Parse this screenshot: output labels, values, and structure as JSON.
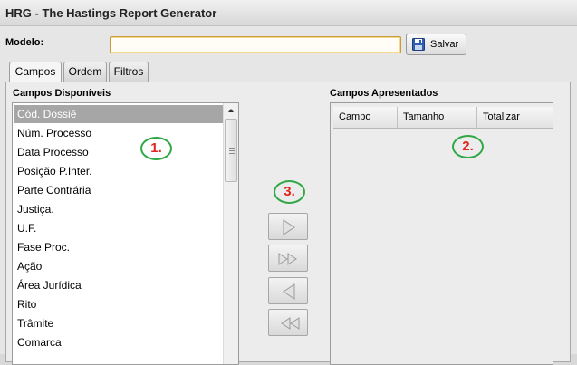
{
  "window": {
    "title": "HRG - The Hastings Report Generator"
  },
  "modelo": {
    "label": "Modelo:",
    "value": "",
    "save_label": "Salvar"
  },
  "tabs": [
    {
      "label": "Campos",
      "active": true
    },
    {
      "label": "Ordem",
      "active": false
    },
    {
      "label": "Filtros",
      "active": false
    }
  ],
  "available": {
    "header": "Campos Disponíveis",
    "items": [
      {
        "label": "Cód. Dossiê",
        "selected": true
      },
      {
        "label": "Núm. Processo"
      },
      {
        "label": "Data Processo"
      },
      {
        "label": "Posição P.Inter."
      },
      {
        "label": "Parte Contrária"
      },
      {
        "label": "Justiça."
      },
      {
        "label": "U.F."
      },
      {
        "label": "Fase Proc."
      },
      {
        "label": "Ação"
      },
      {
        "label": "Área Jurídica"
      },
      {
        "label": "Rito"
      },
      {
        "label": "Trâmite"
      },
      {
        "label": "Comarca"
      }
    ]
  },
  "presented": {
    "header": "Campos Apresentados",
    "columns": [
      "Campo",
      "Tamanho",
      "Totalizar"
    ]
  },
  "annotations": {
    "one": "1.",
    "two": "2.",
    "three": "3."
  },
  "icons": {
    "save": "floppy-disk-icon",
    "move_right": "arrow-right-icon",
    "move_all_right": "double-arrow-right-icon",
    "move_left": "arrow-left-icon",
    "move_all_left": "double-arrow-left-icon"
  },
  "colors": {
    "selection": "#a6a6a6",
    "annotation_text": "#e0261e",
    "annotation_ring": "#2fa845"
  }
}
